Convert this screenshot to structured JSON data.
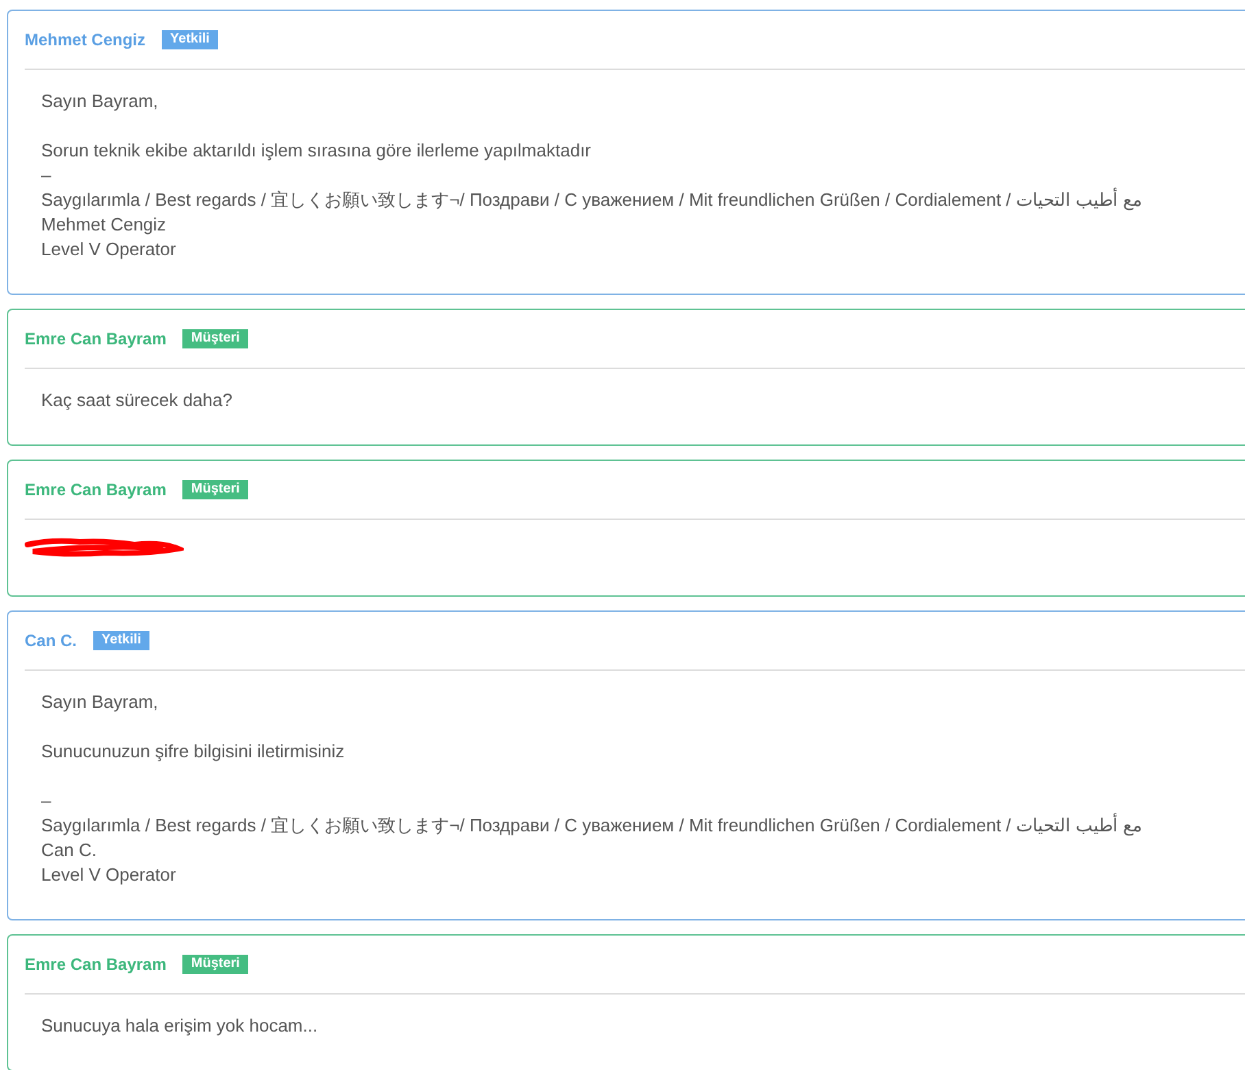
{
  "messages": [
    {
      "author": "Mehmet Cengiz",
      "kind": "staff",
      "badge": "Yetkili",
      "redacted": false,
      "lines": [
        {
          "kind": "text",
          "text": "Sayın Bayram,"
        },
        {
          "kind": "blank"
        },
        {
          "kind": "text",
          "text": "Sorun teknik ekibe aktarıldı işlem sırasına göre ilerleme yapılmaktadır"
        },
        {
          "kind": "text",
          "text": "–"
        },
        {
          "kind": "text",
          "text": "Saygılarımla / Best regards / 宜しくお願い致します¬/ Поздрави / С уважением / Mit freundlichen Grüßen / Cordialement / مع أطيب التحيات"
        },
        {
          "kind": "text",
          "text": "Mehmet Cengiz"
        },
        {
          "kind": "text",
          "text": "Level V Operator"
        }
      ]
    },
    {
      "author": "Emre Can Bayram",
      "kind": "customer",
      "badge": "Müşteri",
      "redacted": false,
      "lines": [
        {
          "kind": "text",
          "text": "Kaç saat sürecek daha?"
        }
      ]
    },
    {
      "author": "Emre Can Bayram",
      "kind": "customer",
      "badge": "Müşteri",
      "redacted": true
    },
    {
      "author": "Can C.",
      "kind": "staff",
      "badge": "Yetkili",
      "redacted": false,
      "lines": [
        {
          "kind": "text",
          "text": "Sayın Bayram,"
        },
        {
          "kind": "blank"
        },
        {
          "kind": "text",
          "text": "Sunucunuzun şifre bilgisini iletirmisiniz"
        },
        {
          "kind": "blank"
        },
        {
          "kind": "text",
          "text": "–"
        },
        {
          "kind": "text",
          "text": "Saygılarımla / Best regards / 宜しくお願い致します¬/ Поздрави / С уважением / Mit freundlichen Grüßen / Cordialement / مع أطيب التحيات"
        },
        {
          "kind": "text",
          "text": "Can C."
        },
        {
          "kind": "text",
          "text": "Level V Operator"
        }
      ]
    },
    {
      "author": "Emre Can Bayram",
      "kind": "customer",
      "badge": "Müşteri",
      "redacted": false,
      "lines": [
        {
          "kind": "text",
          "text": "Sunucuya hala erişim yok hocam..."
        }
      ]
    }
  ]
}
